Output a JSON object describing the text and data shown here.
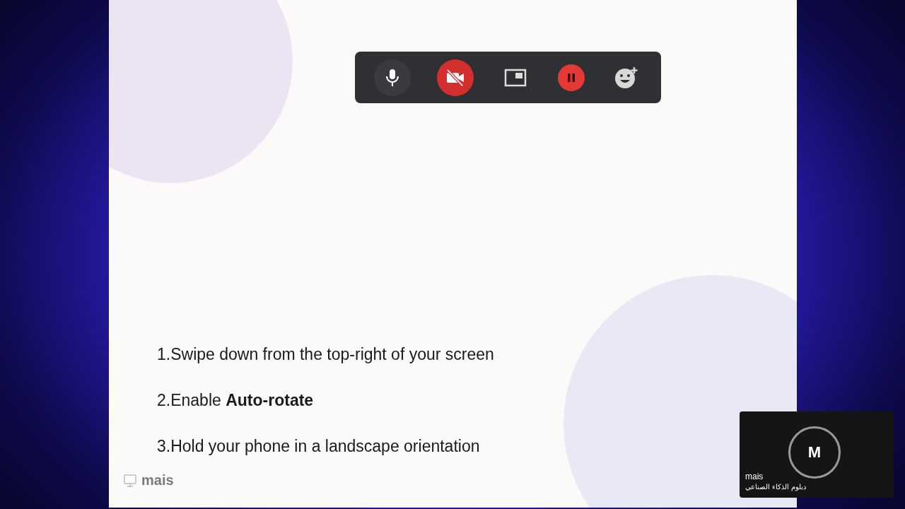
{
  "toolbar": {
    "buttons": [
      {
        "kind": "mic",
        "on": true
      },
      {
        "kind": "camera",
        "on": false
      },
      {
        "kind": "pip"
      },
      {
        "kind": "pause"
      },
      {
        "kind": "reaction"
      }
    ]
  },
  "slide": {
    "steps": [
      "1.Swipe down from the top-right of your screen",
      "2.Enable **Auto-rotate**",
      "3.Hold your phone in a landscape orientation"
    ]
  },
  "presenter": {
    "name": "mais"
  },
  "participant": {
    "initial": "M",
    "name": "mais",
    "subtitle": "دبلوم الذكاء الصناعي"
  }
}
